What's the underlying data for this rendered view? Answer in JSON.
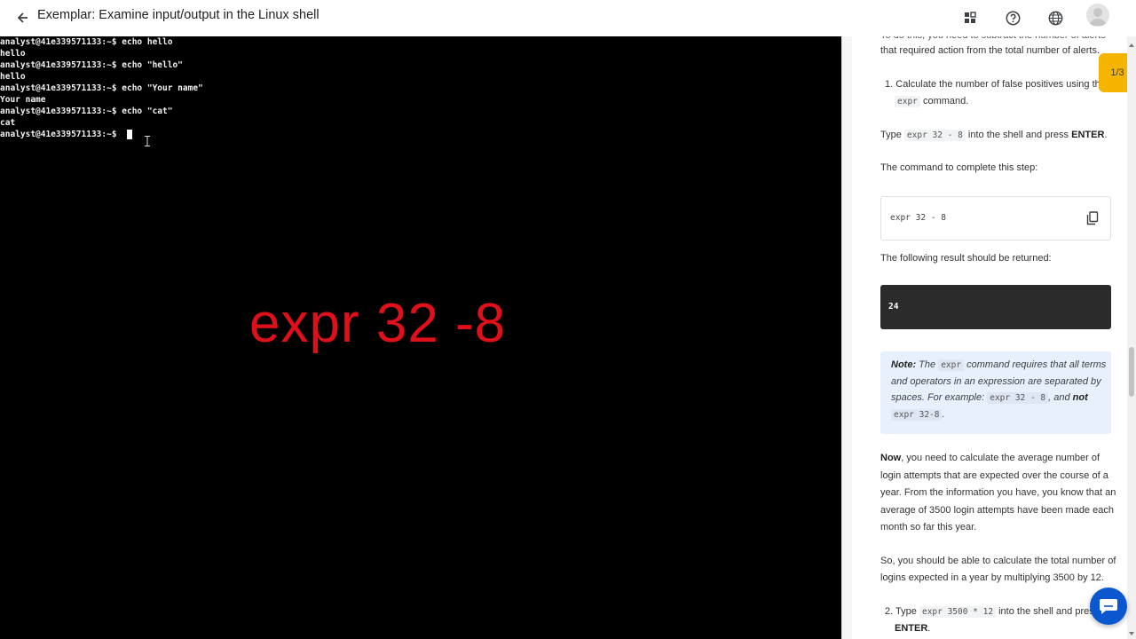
{
  "header": {
    "title": "Exemplar: Examine input/output in the Linux shell",
    "icons": [
      "back-arrow-icon",
      "grid-icon",
      "help-icon",
      "globe-icon",
      "avatar"
    ]
  },
  "terminal": {
    "lines": [
      "analyst@41e339571133:~$ echo hello",
      "hello",
      "analyst@41e339571133:~$ echo \"hello\"",
      "hello",
      "analyst@41e339571133:~$ echo \"Your name\"",
      "Your name",
      "analyst@41e339571133:~$ echo \"cat\"",
      "cat",
      "analyst@41e339571133:~$ "
    ],
    "overlay_text": "expr 32 -8",
    "overlay_color": "#e0101b"
  },
  "panel": {
    "cut_line_1": "To do this, you need to subtract the number of alerts",
    "cut_line_2": "that required action from the total number of alerts.",
    "step1_num": "1.",
    "step1_text": "Calculate the number of false positives using the",
    "step1_code": "expr",
    "step1_tail": "command.",
    "type_prefix": "Type",
    "type_code": "expr 32 - 8",
    "type_mid": "into the shell and press",
    "type_key": "ENTER",
    "type_end": ".",
    "cmd_label": "The command to complete this step:",
    "cmd_value": "expr 32 - 8",
    "result_label": "The following result should be returned:",
    "result_value": "24",
    "note": {
      "label": "Note:",
      "l1a": "The",
      "l1code": "expr",
      "l1b": "command requires that all terms",
      "l2": "and operators in an expression are separated by",
      "l3a": "spaces. For example:",
      "l3code": "expr 32 - 8",
      "l3b": ", and",
      "l3not": "not",
      "l4code": "expr 32-8",
      "l4b": "."
    },
    "now_bold": "Now",
    "now_1": ", you need to calculate the average number of",
    "now_2": "login attempts that are expected over the course of a",
    "now_3": "year. From the information you have, you know that an",
    "now_4": "average of 3500 login attempts have been made each",
    "now_5": "month so far this year.",
    "so_1": "So, you should be able to calculate the total number of",
    "so_2": "logins expected in a year by multiplying 3500 by 12.",
    "step2_num": "2.",
    "step2_a": "Type",
    "step2_code": "expr 3500 * 12",
    "step2_b": "into the shell and press",
    "step2_key": "ENTER",
    "step2_end": "."
  },
  "page_badge": "1/3",
  "colors": {
    "accent": "#f4b400",
    "chat": "#0b57d0"
  }
}
